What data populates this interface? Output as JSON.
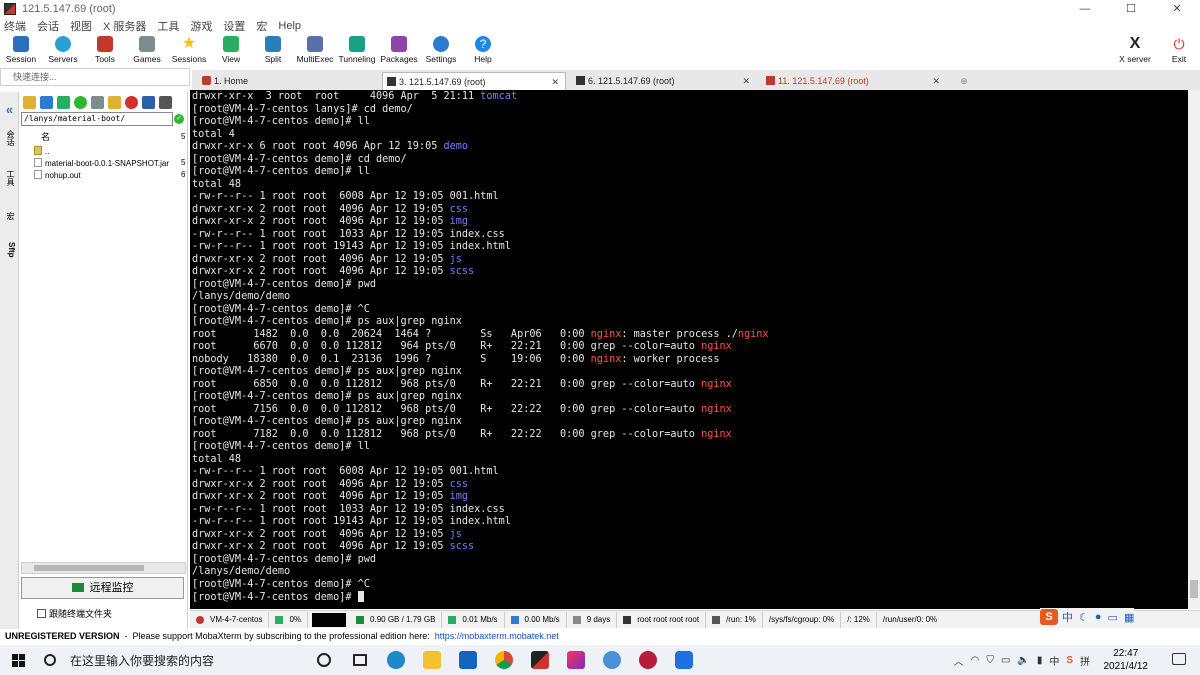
{
  "window": {
    "title": "121.5.147.69 (root)",
    "min": "—",
    "max": "☐",
    "close": "✕"
  },
  "menu": [
    "终端",
    "会话",
    "视图",
    "X 服务器",
    "工具",
    "游戏",
    "设置",
    "宏",
    "Help"
  ],
  "toolbar": [
    {
      "label": "Session",
      "color": "#2d6fbf"
    },
    {
      "label": "Servers",
      "color": "#2a9fd6"
    },
    {
      "label": "Tools",
      "color": "#c0392b"
    },
    {
      "label": "Games",
      "color": "#7f8c8d"
    },
    {
      "label": "Sessions",
      "color": "#f1c40f"
    },
    {
      "label": "View",
      "color": "#27ae60"
    },
    {
      "label": "Split",
      "color": "#2980b9"
    },
    {
      "label": "MultiExec",
      "color": "#5b6fa8"
    },
    {
      "label": "Tunneling",
      "color": "#16a085"
    },
    {
      "label": "Packages",
      "color": "#8e44ad"
    },
    {
      "label": "Settings",
      "color": "#2c7bd0"
    },
    {
      "label": "Help",
      "color": "#1e88e5"
    }
  ],
  "toolbar_right": [
    {
      "label": "X server",
      "color": "#222222"
    },
    {
      "label": "Exit",
      "color": "#d32f2f"
    }
  ],
  "tabs": [
    {
      "label": "1. Home"
    },
    {
      "label": "3. 121.5.147.69 (root)",
      "close": "✕"
    },
    {
      "label": "6. 121.5.147.69 (root)",
      "close": "✕"
    },
    {
      "label": "11. 121.5.147.69 (root)",
      "close": "✕"
    }
  ],
  "sidebar": {
    "quick_connect_placeholder": "快速连接...",
    "path": "/lanys/material-boot/",
    "col_name": "名",
    "files": [
      {
        "name": "..",
        "num": "5"
      },
      {
        "name": "material-boot-0.0.1-SNAPSHOT.jar",
        "num": "5"
      },
      {
        "name": "nohup.out",
        "num": "6"
      }
    ],
    "remote_monitor": "远程监控",
    "follow_terminal": "跟随终端文件夹",
    "vtabs": [
      "会话",
      "工具",
      "宏",
      "Sftp"
    ]
  },
  "terminal": {
    "lines": [
      [
        [
          "drwxr-xr-x  3 root  root     4096 Apr  5 21:11 ",
          ""
        ],
        [
          "tomcat",
          "blue"
        ]
      ],
      [
        [
          "[root@VM-4-7-centos lanys]# cd demo/",
          ""
        ]
      ],
      [
        [
          "[root@VM-4-7-centos demo]# ll",
          ""
        ]
      ],
      [
        [
          "total 4",
          ""
        ]
      ],
      [
        [
          "drwxr-xr-x 6 root root 4096 Apr 12 19:05 ",
          ""
        ],
        [
          "demo",
          "blue"
        ]
      ],
      [
        [
          "[root@VM-4-7-centos demo]# cd demo/",
          ""
        ]
      ],
      [
        [
          "[root@VM-4-7-centos demo]# ll",
          ""
        ]
      ],
      [
        [
          "total 48",
          ""
        ]
      ],
      [
        [
          "-rw-r--r-- 1 root root  6008 Apr 12 19:05 001.html",
          ""
        ]
      ],
      [
        [
          "drwxr-xr-x 2 root root  4096 Apr 12 19:05 ",
          ""
        ],
        [
          "css",
          "blue"
        ]
      ],
      [
        [
          "drwxr-xr-x 2 root root  4096 Apr 12 19:05 ",
          ""
        ],
        [
          "img",
          "blue"
        ]
      ],
      [
        [
          "-rw-r--r-- 1 root root  1033 Apr 12 19:05 index.css",
          ""
        ]
      ],
      [
        [
          "-rw-r--r-- 1 root root 19143 Apr 12 19:05 index.html",
          ""
        ]
      ],
      [
        [
          "drwxr-xr-x 2 root root  4096 Apr 12 19:05 ",
          ""
        ],
        [
          "js",
          "blue"
        ]
      ],
      [
        [
          "drwxr-xr-x 2 root root  4096 Apr 12 19:05 ",
          ""
        ],
        [
          "scss",
          "blue"
        ]
      ],
      [
        [
          "[root@VM-4-7-centos demo]# pwd",
          ""
        ]
      ],
      [
        [
          "/lanys/demo/demo",
          ""
        ]
      ],
      [
        [
          "[root@VM-4-7-centos demo]# ^C",
          ""
        ]
      ],
      [
        [
          "[root@VM-4-7-centos demo]# ps aux|grep nginx",
          ""
        ]
      ],
      [
        [
          "root      1482  0.0  0.0  20624  1464 ?        Ss   Apr06   0:00 ",
          ""
        ],
        [
          "nginx",
          "red"
        ],
        [
          ": master process ./",
          ""
        ],
        [
          "nginx",
          "red"
        ]
      ],
      [
        [
          "root      6670  0.0  0.0 112812   964 pts/0    R+   22:21   0:00 grep --color=auto ",
          ""
        ],
        [
          "nginx",
          "red"
        ]
      ],
      [
        [
          "nobody   18380  0.0  0.1  23136  1996 ?        S    19:06   0:00 ",
          ""
        ],
        [
          "nginx",
          "red"
        ],
        [
          ": worker process",
          ""
        ]
      ],
      [
        [
          "[root@VM-4-7-centos demo]# ps aux|grep nginx",
          ""
        ]
      ],
      [
        [
          "root      6850  0.0  0.0 112812   968 pts/0    R+   22:21   0:00 grep --color=auto ",
          ""
        ],
        [
          "nginx",
          "red"
        ]
      ],
      [
        [
          "[root@VM-4-7-centos demo]# ps aux|grep nginx",
          ""
        ]
      ],
      [
        [
          "root      7156  0.0  0.0 112812   968 pts/0    R+   22:22   0:00 grep --color=auto ",
          ""
        ],
        [
          "nginx",
          "red"
        ]
      ],
      [
        [
          "[root@VM-4-7-centos demo]# ps aux|grep nginx",
          ""
        ]
      ],
      [
        [
          "root      7182  0.0  0.0 112812   968 pts/0    R+   22:22   0:00 grep --color=auto ",
          ""
        ],
        [
          "nginx",
          "red"
        ]
      ],
      [
        [
          "[root@VM-4-7-centos demo]# ll",
          ""
        ]
      ],
      [
        [
          "total 48",
          ""
        ]
      ],
      [
        [
          "-rw-r--r-- 1 root root  6008 Apr 12 19:05 001.html",
          ""
        ]
      ],
      [
        [
          "drwxr-xr-x 2 root root  4096 Apr 12 19:05 ",
          ""
        ],
        [
          "css",
          "blue"
        ]
      ],
      [
        [
          "drwxr-xr-x 2 root root  4096 Apr 12 19:05 ",
          ""
        ],
        [
          "img",
          "blue"
        ]
      ],
      [
        [
          "-rw-r--r-- 1 root root  1033 Apr 12 19:05 index.css",
          ""
        ]
      ],
      [
        [
          "-rw-r--r-- 1 root root 19143 Apr 12 19:05 index.html",
          ""
        ]
      ],
      [
        [
          "drwxr-xr-x 2 root root  4096 Apr 12 19:05 ",
          ""
        ],
        [
          "js",
          "blue"
        ]
      ],
      [
        [
          "drwxr-xr-x 2 root root  4096 Apr 12 19:05 ",
          ""
        ],
        [
          "scss",
          "blue"
        ]
      ],
      [
        [
          "[root@VM-4-7-centos demo]# pwd",
          ""
        ]
      ],
      [
        [
          "/lanys/demo/demo",
          ""
        ]
      ],
      [
        [
          "[root@VM-4-7-centos demo]# ^C",
          ""
        ]
      ],
      [
        [
          "[root@VM-4-7-centos demo]# ",
          ""
        ]
      ]
    ]
  },
  "status": {
    "host": "VM-4-7-centos",
    "cpu": "0%",
    "memory": "0.90 GB / 1.79 GB",
    "upload": "0.01 Mb/s",
    "download": "0.00 Mb/s",
    "uptime": "9 days",
    "users": "root  root  root  root",
    "disk1": "/run: 1%",
    "disk2": "/sys/fs/cgroup: 0%",
    "disk3": "/: 12%",
    "disk4": "/run/user/0: 0%"
  },
  "unregistered": {
    "label": "UNREGISTERED VERSION",
    "message": "  -  Please support MobaXterm by subscribing to the professional edition here:  ",
    "link": "https://mobaxterm.mobatek.net"
  },
  "taskbar": {
    "search_placeholder": "在这里输入你要搜索的内容",
    "time": "22:47",
    "date": "2021/4/12",
    "tray_text": [
      "中",
      "拼"
    ]
  },
  "colors": {
    "terminal_bg": "#000000",
    "terminal_fg": "#e6e6e6",
    "dir_blue": "#7b7bff",
    "match_red": "#ff4f4f"
  }
}
